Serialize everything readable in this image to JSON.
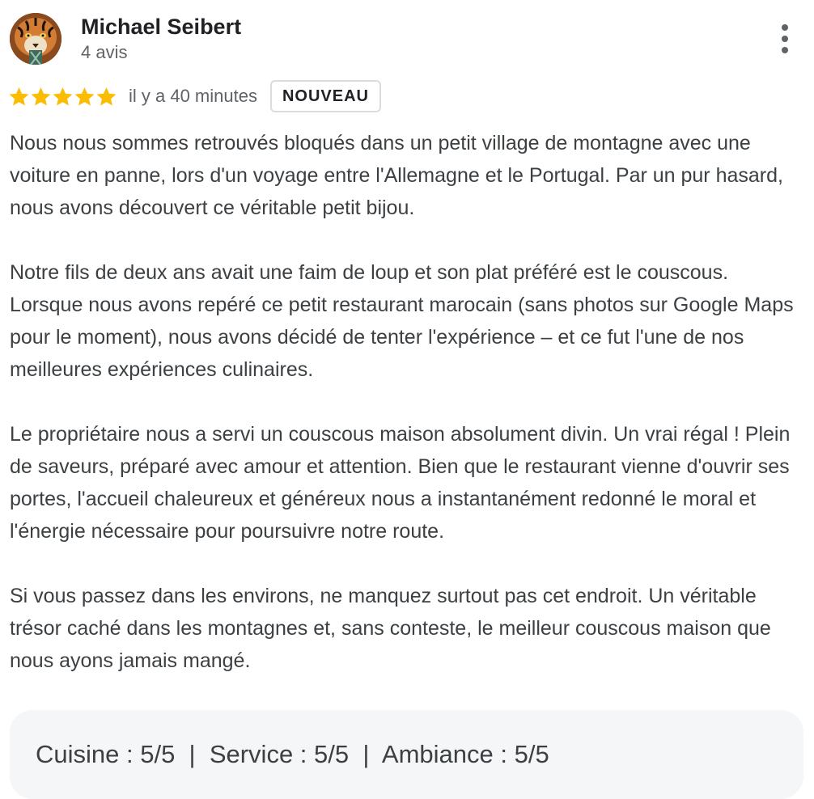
{
  "author": {
    "name": "Michael Seibert",
    "reviews_count": "4 avis",
    "avatar_icon": "tiger-avatar-icon"
  },
  "more_menu_icon": "more-vertical-icon",
  "rating": {
    "stars": 5,
    "max_stars": 5,
    "star_color": "#fbbc04",
    "time_ago": "il y a 40 minutes",
    "badge": "NOUVEAU"
  },
  "review": {
    "paragraphs": [
      "Nous nous sommes retrouvés bloqués dans un petit village de montagne avec une voiture en panne, lors d'un voyage entre l'Allemagne et le Portugal. Par un pur hasard, nous avons découvert ce véritable petit bijou.",
      "Notre fils de deux ans avait une faim de loup et son plat préféré est le couscous. Lorsque nous avons repéré ce petit restaurant marocain (sans photos sur Google Maps pour le moment), nous avons décidé de tenter l'expérience – et ce fut l'une de nos meilleures expériences culinaires.",
      "Le propriétaire nous a servi un couscous maison absolument divin. Un vrai régal ! Plein de saveurs, préparé avec amour et attention. Bien que le restaurant vienne d'ouvrir ses portes, l'accueil chaleureux et généreux nous a instantanément redonné le moral et l'énergie nécessaire pour poursuivre notre route.",
      "Si vous passez dans les environs, ne manquez surtout pas cet endroit. Un véritable trésor caché dans les montagnes et, sans conteste, le meilleur couscous maison que nous ayons jamais mangé."
    ]
  },
  "sub_ratings": {
    "text": "Cuisine : 5/5  |  Service : 5/5  |  Ambiance : 5/5"
  }
}
